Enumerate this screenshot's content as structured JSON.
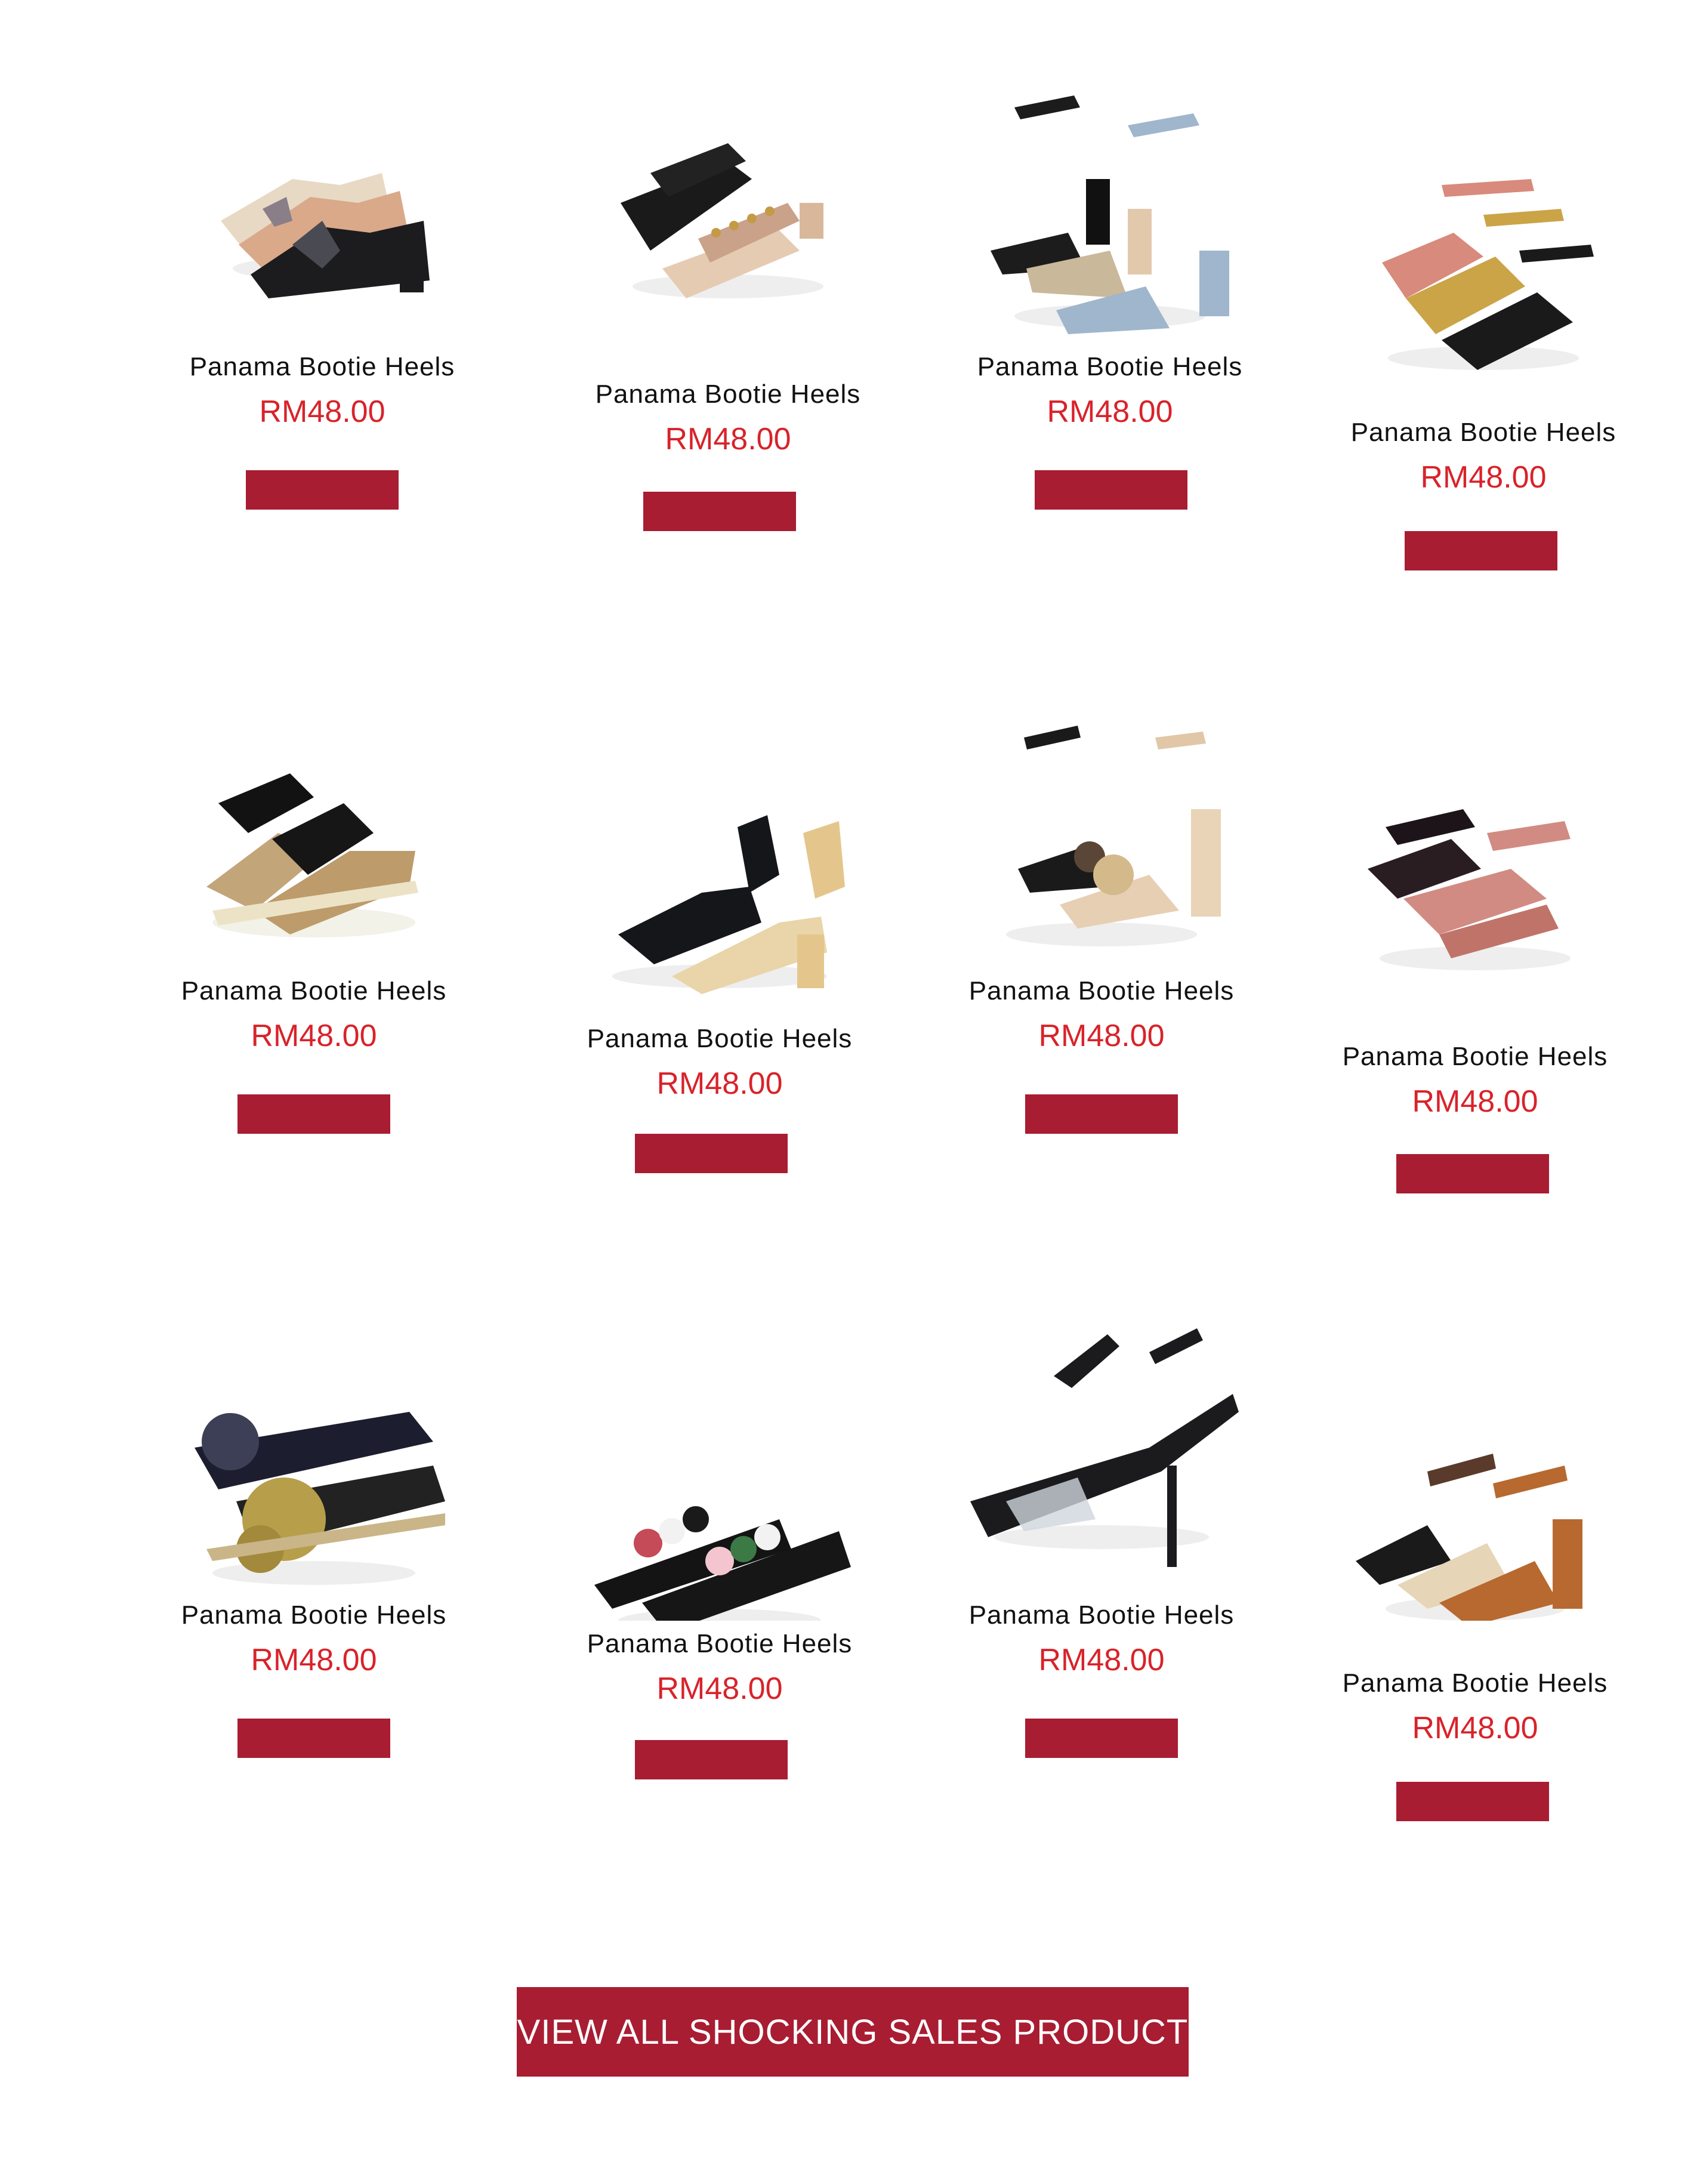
{
  "products": [
    {
      "name": "Panama Bootie Heels",
      "price": "RM48.00"
    },
    {
      "name": "Panama Bootie Heels",
      "price": "RM48.00"
    },
    {
      "name": "Panama Bootie Heels",
      "price": "RM48.00"
    },
    {
      "name": "Panama Bootie Heels",
      "price": "RM48.00"
    },
    {
      "name": "Panama Bootie Heels",
      "price": "RM48.00"
    },
    {
      "name": "Panama Bootie Heels",
      "price": "RM48.00"
    },
    {
      "name": "Panama Bootie Heels",
      "price": "RM48.00"
    },
    {
      "name": "Panama Bootie Heels",
      "price": "RM48.00"
    },
    {
      "name": "Panama Bootie Heels",
      "price": "RM48.00"
    },
    {
      "name": "Panama Bootie Heels",
      "price": "RM48.00"
    },
    {
      "name": "Panama Bootie Heels",
      "price": "RM48.00"
    },
    {
      "name": "Panama Bootie Heels",
      "price": "RM48.00"
    }
  ],
  "view_all_label": "VIEW ALL SHOCKING SALES PRODUCT",
  "colors": {
    "price": "#d8232a",
    "button": "#a81d32"
  }
}
